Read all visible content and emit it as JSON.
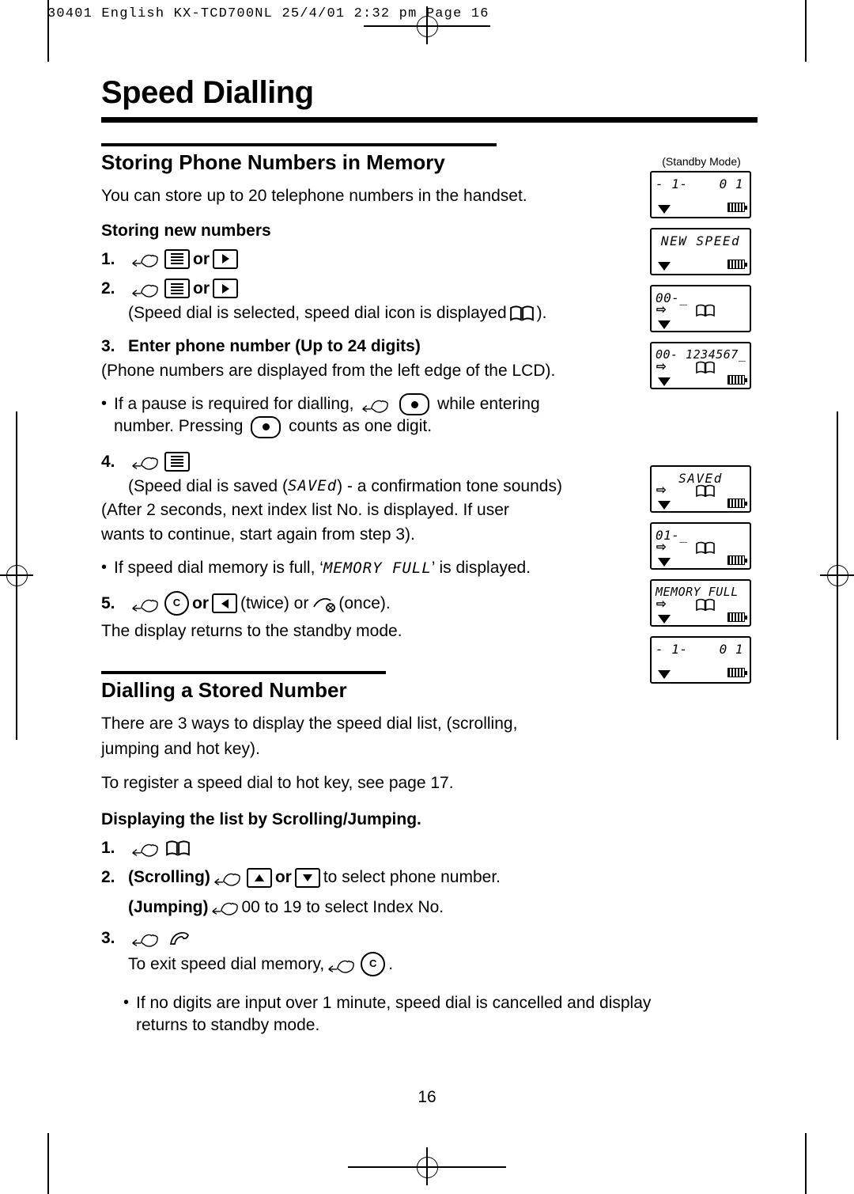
{
  "header": {
    "strip": "30401 English KX-TCD700NL  25/4/01  2:32 pm  Page 16"
  },
  "page": {
    "title": "Speed Dialling",
    "number": "16"
  },
  "sections": [
    {
      "heading": "Storing Phone Numbers in Memory",
      "intro": "You can store up to 20 telephone numbers in the handset.",
      "subhead": "Storing new numbers",
      "steps": [
        {
          "num": "1.",
          "text_before": "",
          "text_after": "or"
        },
        {
          "num": "2.",
          "text_before": "",
          "text_after": "or"
        },
        {
          "num": "3.",
          "bold_text": "Enter phone number (Up to 24 digits)"
        },
        {
          "num": "4.",
          "text_before": "",
          "text_after": ""
        },
        {
          "num": "5.",
          "text_before": "",
          "text_after": "or"
        }
      ],
      "notes": {
        "step2_note": "(Speed dial is selected, speed dial icon is displayed",
        "step2_note_end": ").",
        "step3_note": "(Phone numbers are displayed from the left edge of the LCD).",
        "pause_note_a": "If a pause is required for dialling,",
        "pause_note_b": "while entering",
        "pause_note_c": "number. Pressing",
        "pause_note_d": "counts as one digit.",
        "step4_note_a": "(Speed dial is saved (",
        "step4_saved": "SAVEd",
        "step4_note_b": ") - a confirmation tone sounds)",
        "step4_note_c": "(After 2 seconds, next index list No. is displayed. If user",
        "step4_note_d": "wants to continue, start again from step 3).",
        "memory_full_a": "If speed dial memory is full, ‘",
        "memory_full_word": "MEMORY FULL",
        "memory_full_b": "’ is displayed.",
        "step5_twice": "(twice) or",
        "step5_once": "(once).",
        "step5_note": "The display returns to the standby mode."
      }
    },
    {
      "heading": "Dialling a Stored Number",
      "paras": [
        "There are 3 ways to display the speed dial list, (scrolling,",
        "jumping and hot key).",
        "To register a speed dial to hot key, see page 17."
      ],
      "subhead": "Displaying the list by Scrolling/Jumping.",
      "steps": {
        "s1": "1.",
        "s2": "2.",
        "s2_label": "(Scrolling)",
        "s2_or": "or",
        "s2_tail": "to select phone number.",
        "jump_label": "(Jumping)",
        "jump_text": "00 to 19 to select Index No.",
        "s3": "3.",
        "exit_text": "To exit speed dial memory,",
        "exit_end": ".",
        "final_note_a": "If no digits are input over 1 minute, speed dial is cancelled and display",
        "final_note_b": "returns to standby mode."
      }
    }
  ],
  "lcd_panels": {
    "standby_label": "(Standby Mode)",
    "panels": [
      {
        "name": "standby-1",
        "left": "- 1-",
        "right": "0 1",
        "icons": [
          "antenna",
          "battery"
        ]
      },
      {
        "name": "new-speed",
        "center": "NEW SPEEd",
        "icons": [
          "antenna",
          "battery"
        ]
      },
      {
        "name": "index-00",
        "left": "00-_",
        "icons": [
          "arrow",
          "antenna",
          "book"
        ]
      },
      {
        "name": "number-entry",
        "left": "00- 1234567_",
        "icons": [
          "arrow",
          "antenna",
          "book",
          "battery"
        ]
      },
      {
        "name": "saved",
        "center": "SAVEd",
        "icons": [
          "arrow",
          "antenna",
          "book",
          "battery"
        ]
      },
      {
        "name": "index-01",
        "left": "01-_",
        "icons": [
          "arrow",
          "antenna",
          "book",
          "battery"
        ]
      },
      {
        "name": "memory-full",
        "center": "MEMORY FULL",
        "icons": [
          "arrow",
          "antenna",
          "book",
          "battery"
        ]
      },
      {
        "name": "standby-2",
        "left": "- 1-",
        "right": "0 1",
        "icons": [
          "antenna",
          "battery"
        ]
      }
    ]
  }
}
